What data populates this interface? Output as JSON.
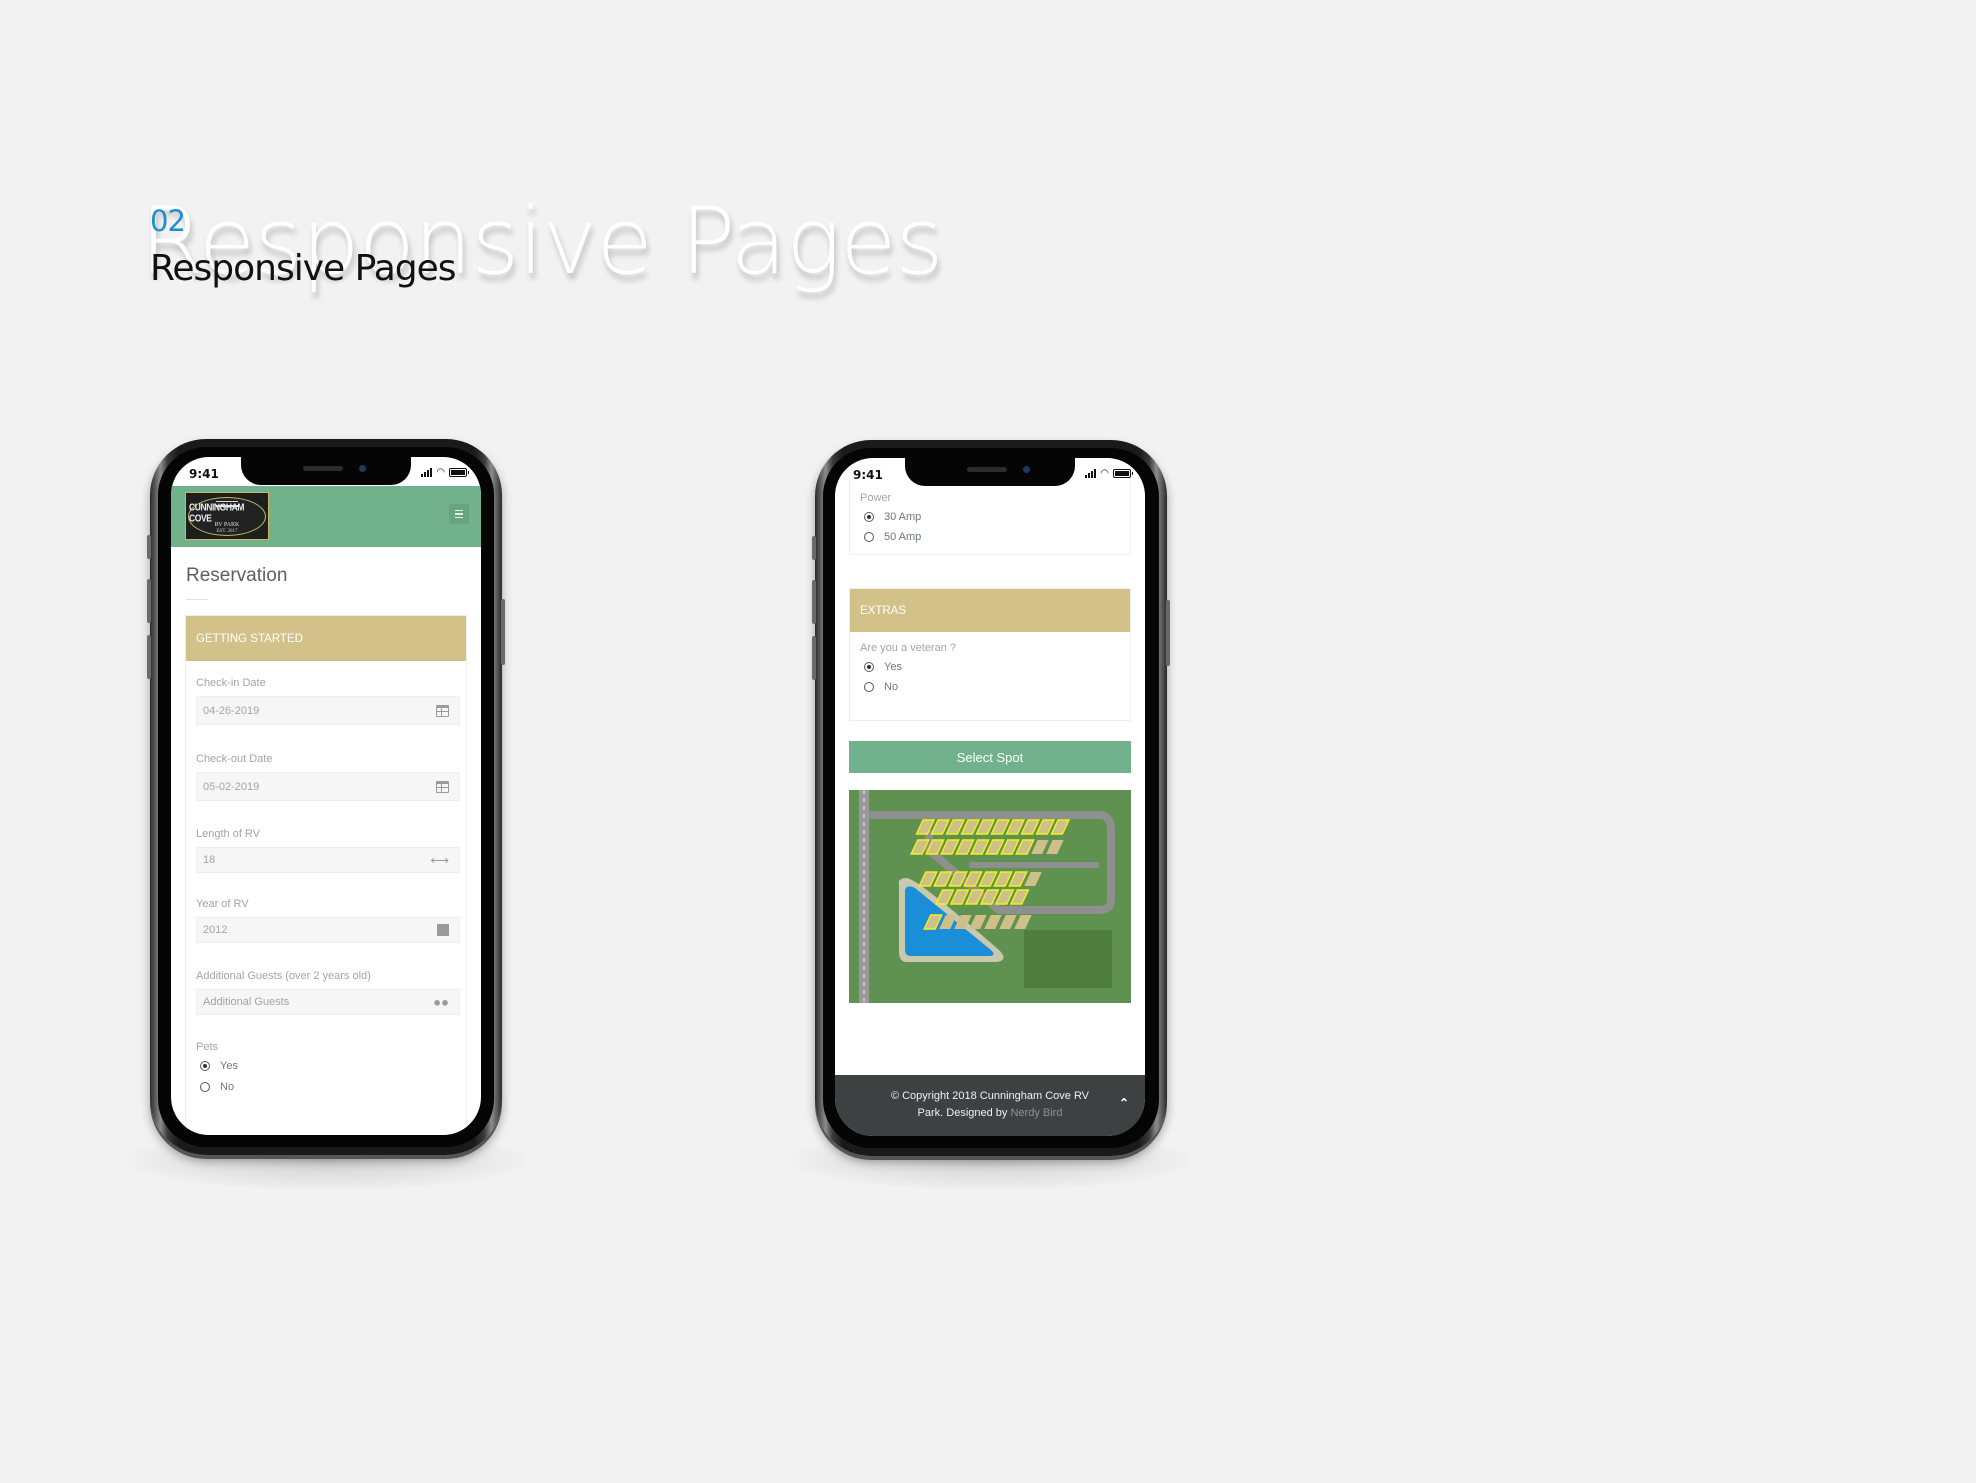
{
  "section": {
    "number": "02",
    "ghost_title": "Responsive Pages",
    "title": "Responsive Pages"
  },
  "colors": {
    "section_number": "#1a8fd6",
    "header_green": "#71b28c",
    "card_header_gold": "#d2c28a",
    "footer_dark": "#3e4142"
  },
  "phone_left": {
    "status_time": "9:41",
    "header": {
      "logo": {
        "line1": "CUNNINGHAM COVE",
        "line2": "RV PARK",
        "line3": "EST. 2017"
      },
      "menu_icon": "hamburger-icon"
    },
    "page_title": "Reservation",
    "card_title": "GETTING STARTED",
    "fields": [
      {
        "label": "Check-in Date",
        "value": "04-26-2019",
        "icon": "calendar-icon"
      },
      {
        "label": "Check-out Date",
        "value": "05-02-2019",
        "icon": "calendar-icon"
      },
      {
        "label": "Length of RV",
        "value": "18",
        "icon": "arrows-horizontal-icon"
      },
      {
        "label": "Year of RV",
        "value": "2012",
        "icon": "year-icon",
        "icon_glyph": "Y"
      },
      {
        "label": "Additional Guests (over 2 years old)",
        "placeholder": "Additional Guests",
        "icon": "users-icon"
      }
    ],
    "pets": {
      "label": "Pets",
      "options": [
        {
          "label": "Yes",
          "selected": true
        },
        {
          "label": "No",
          "selected": false
        }
      ]
    }
  },
  "phone_right": {
    "status_time": "9:41",
    "power": {
      "label": "Power",
      "options": [
        {
          "label": "30 Amp",
          "selected": true
        },
        {
          "label": "50 Amp",
          "selected": false
        }
      ]
    },
    "extras_title": "EXTRAS",
    "veteran": {
      "label": "Are you a veteran ?",
      "options": [
        {
          "label": "Yes",
          "selected": true
        },
        {
          "label": "No",
          "selected": false
        }
      ]
    },
    "select_spot_label": "Select Spot",
    "map_alt": "RV park site map",
    "footer": {
      "copyright": "© Copyright 2018 Cunningham Cove RV",
      "line2_prefix": "Park. Designed by ",
      "designer": "Nerdy Bird",
      "back_to_top_icon": "chevron-up-icon"
    }
  }
}
